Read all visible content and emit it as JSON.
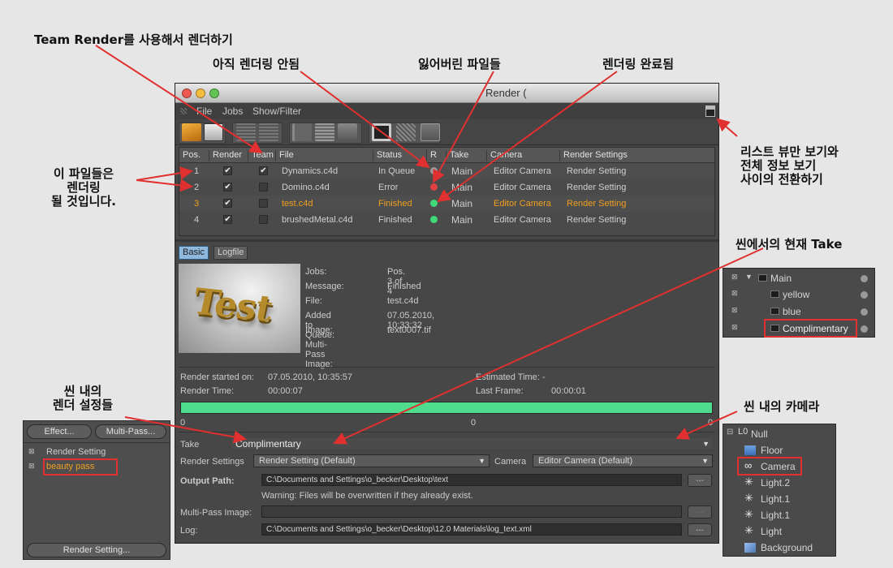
{
  "annotations": {
    "team_render": "Team Render를 사용해서 렌더하기",
    "not_rendered": "아직 렌더링 안됨",
    "lost_files": "잃어버린 파일들",
    "render_done": "렌더링 완료됨",
    "files_rendered": "이 파일들은\n렌더링\n될 것입니다.",
    "toggle_view": "리스트 뷰만 보기와\n전체 정보 보기\n사이의 전환하기",
    "current_take": "씬에서의 현재 Take",
    "scene_settings": "씬 내의\n렌더 설정들",
    "scene_camera": "씬 내의 카메라"
  },
  "window": {
    "title": "Render (",
    "menu": [
      "File",
      "Jobs",
      "Show/Filter"
    ]
  },
  "table": {
    "headers": [
      "Pos.",
      "Render",
      "Team",
      "File",
      "Status",
      "R",
      "Take",
      "Camera",
      "Render Settings"
    ],
    "rows": [
      {
        "pos": "1",
        "render": true,
        "team": true,
        "file": "Dynamics.c4d",
        "status": "In Queue",
        "r": "grey",
        "take": "Main",
        "camera": "Editor Camera",
        "settings": "Render Setting"
      },
      {
        "pos": "2",
        "render": true,
        "team": false,
        "file": "Domino.c4d",
        "status": "Error",
        "r": "red",
        "take": "Main",
        "camera": "Editor Camera",
        "settings": "Render Setting"
      },
      {
        "pos": "3",
        "render": true,
        "team": false,
        "file": "test.c4d",
        "status": "Finished",
        "r": "green",
        "take": "Main",
        "camera": "Editor Camera",
        "settings": "Render Setting"
      },
      {
        "pos": "4",
        "render": true,
        "team": false,
        "file": "brushedMetal.c4d",
        "status": "Finished",
        "r": "green",
        "take": "Main",
        "camera": "Editor Camera",
        "settings": "Render Setting"
      }
    ]
  },
  "tabs": {
    "basic": "Basic",
    "logfile": "Logfile"
  },
  "preview_text": "Test",
  "info": {
    "jobs_label": "Jobs:",
    "jobs": "Pos. 3 of 4",
    "message_label": "Message:",
    "message": "Finished",
    "file_label": "File:",
    "file": "test.c4d",
    "added_label": "Added to Queue:",
    "added": "07.05.2010, 10:33:32",
    "image_label": "Image:",
    "image": "text0007.tif",
    "multipass_label": "Multi-Pass Image:"
  },
  "timing": {
    "started_label": "Render started on:",
    "started": "07.05.2010, 10:35:57",
    "time_label": "Render Time:",
    "time": "00:00:07",
    "est_label": "Estimated Time: -",
    "last_label": "Last Frame:",
    "last": "00:00:01",
    "progress": 1.0,
    "tick_left": "0",
    "tick_mid": "0",
    "tick_right": "0"
  },
  "settings": {
    "take_label": "Take",
    "take": "Complimentary",
    "rs_label": "Render Settings",
    "rs": "Render Setting (Default)",
    "camera_label": "Camera",
    "camera": "Editor Camera (Default)",
    "output_label": "Output Path:",
    "output": "C:\\Documents and Settings\\o_becker\\Desktop\\text",
    "warning": "Warning: Files will be overwritten if they already exist.",
    "multipass_label": "Multi-Pass Image:",
    "log_label": "Log:",
    "log": "C:\\Documents and Settings\\o_becker\\Desktop\\12.0 Materials\\log_text.xml",
    "browse": "..."
  },
  "takes_panel": {
    "items": [
      "Main",
      "yellow",
      "blue",
      "Complimentary"
    ]
  },
  "render_settings_panel": {
    "effect": "Effect...",
    "multipass": "Multi-Pass...",
    "items": [
      "Render Setting",
      "beauty pass"
    ],
    "footer": "Render Setting..."
  },
  "objects_panel": {
    "items": [
      "Null",
      "Floor",
      "Camera",
      "Light.2",
      "Light.1",
      "Light.1",
      "Light",
      "Background"
    ]
  },
  "colors": {
    "highlight": "#f0a020",
    "status_red": "#e04040",
    "status_green": "#3fd977",
    "status_grey": "#9a9a9a",
    "callout_red": "#e0302f",
    "progress": "#4fdc8e"
  }
}
